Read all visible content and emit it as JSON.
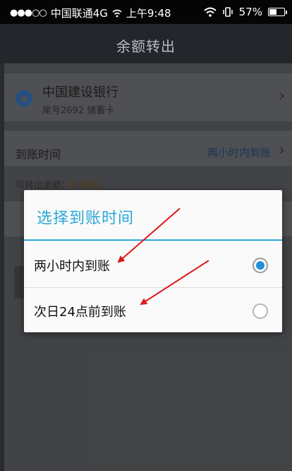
{
  "status_bar": {
    "signal": "●●●○○",
    "carrier": "中国联通4G",
    "time": "上午9:48",
    "battery": "57%",
    "battery_level": 0.57
  },
  "header": {
    "title": "余额转出"
  },
  "bank": {
    "name": "中国建设银行",
    "subtitle": "尾号2692 储蓄卡"
  },
  "arrival": {
    "label": "到账时间",
    "value": "两小时内到账"
  },
  "available": {
    "label": "可转出余额：",
    "amount": "8.69元"
  },
  "dialog": {
    "title": "选择到账时间",
    "options": [
      {
        "label": "两小时内到账",
        "selected": true
      },
      {
        "label": "次日24点前到账",
        "selected": false
      }
    ]
  },
  "colors": {
    "accent": "#29a8d8",
    "radio_selected": "#1f8fd6",
    "annotation_arrow": "#e01818"
  },
  "icons": {
    "chevron": "›",
    "radio_selected": "radio-checked-icon",
    "radio_unselected": "radio-unchecked-icon"
  }
}
